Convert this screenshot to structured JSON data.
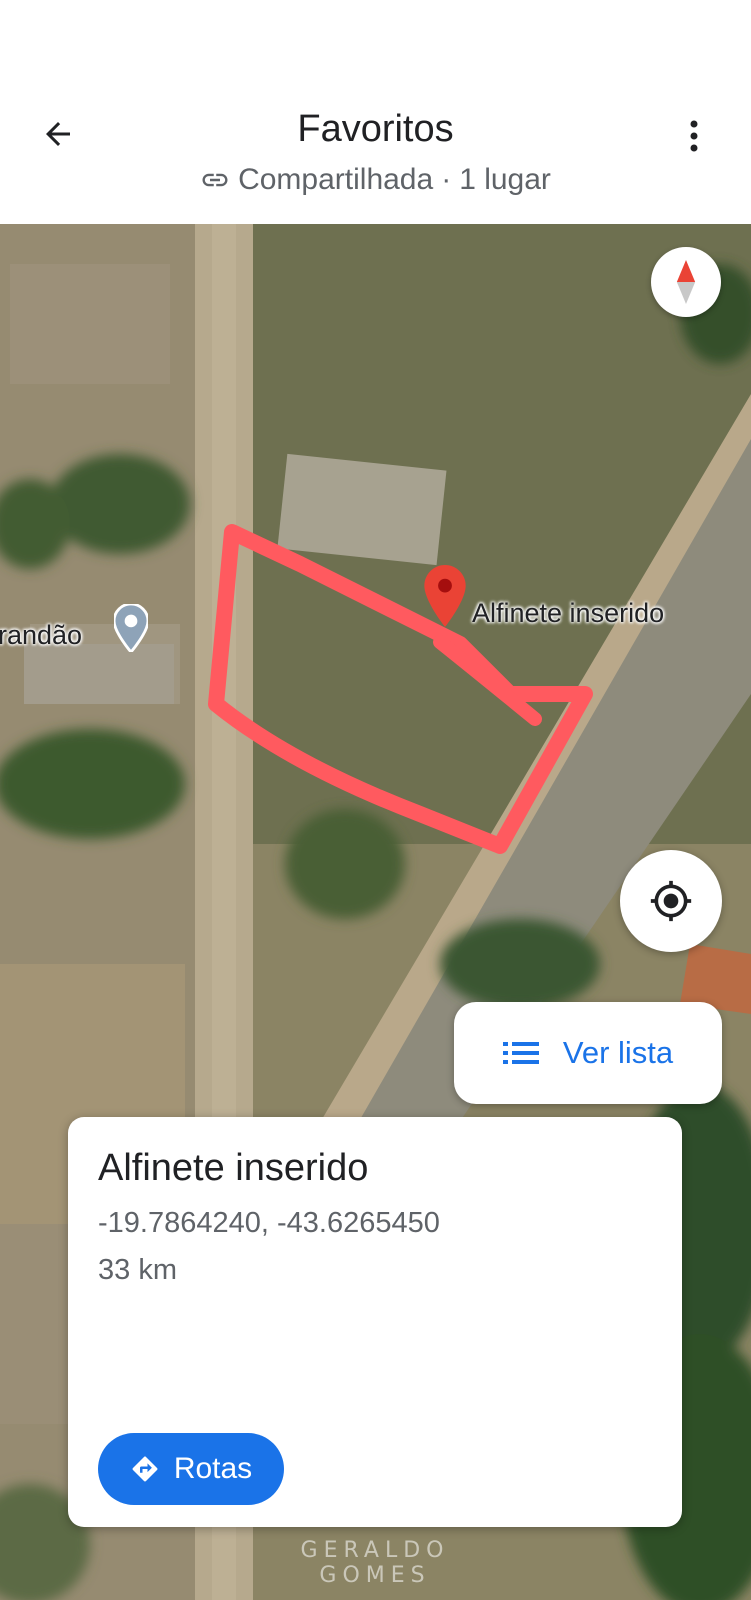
{
  "header": {
    "title": "Favoritos",
    "subtitle_shared": "Compartilhada",
    "subtitle_separator": "·",
    "subtitle_count": "1 lugar"
  },
  "icons": {
    "back": "arrow-left-icon",
    "more": "more-vertical-icon",
    "link": "link-icon",
    "compass": "compass-icon",
    "locate": "my-location-icon",
    "list": "list-icon",
    "directions": "directions-icon"
  },
  "map": {
    "pin_label": "Alfinete inserido",
    "poi_label": "randão"
  },
  "buttons": {
    "ver_lista": "Ver lista",
    "rotas": "Rotas"
  },
  "card": {
    "title": "Alfinete inserido",
    "coords": "-19.7864240, -43.6265450",
    "distance": "33 km"
  },
  "watermark": "GERALDO GOMES",
  "colors": {
    "accent": "#1a73e8",
    "pin": "#ea4335",
    "annotation": "#ff5a5f"
  }
}
